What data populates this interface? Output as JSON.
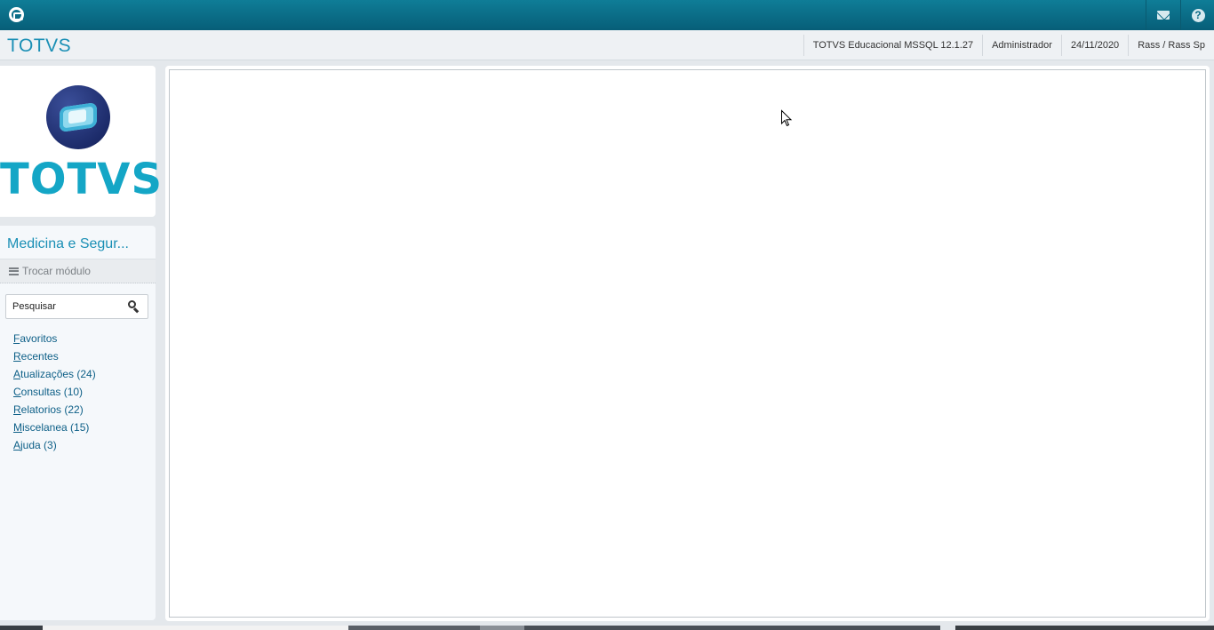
{
  "topbar": {
    "app_icon": "totvs-circle-icon",
    "mail_icon": "mail-icon",
    "help_icon": "help-icon",
    "help_glyph": "?"
  },
  "header": {
    "brand": "TOTVS",
    "info": [
      "TOTVS Educacional MSSQL 12.1.27",
      "Administrador",
      "24/11/2020",
      "Rass / Rass Sp"
    ]
  },
  "sidebar": {
    "logo_text": "TOTVS",
    "module_title": "Medicina e Segur...",
    "switch_module_label": "Trocar módulo",
    "search": {
      "placeholder": "Pesquisar",
      "value": ""
    },
    "menu_items": [
      {
        "mnemonic": "F",
        "rest": "avoritos"
      },
      {
        "mnemonic": "R",
        "rest": "ecentes"
      },
      {
        "mnemonic": "A",
        "rest": "tualizações (24)"
      },
      {
        "mnemonic": "C",
        "rest": "onsultas (10)"
      },
      {
        "mnemonic": "R",
        "rest": "elatorios (22)"
      },
      {
        "mnemonic": "M",
        "rest": "iscelanea (15)"
      },
      {
        "mnemonic": "A",
        "rest": "juda (3)"
      }
    ]
  },
  "colors": {
    "topbar": "#0b6f89",
    "brand": "#1a8fb5",
    "logo_teal": "#14a6c6",
    "menu_link": "#0d5f87"
  }
}
